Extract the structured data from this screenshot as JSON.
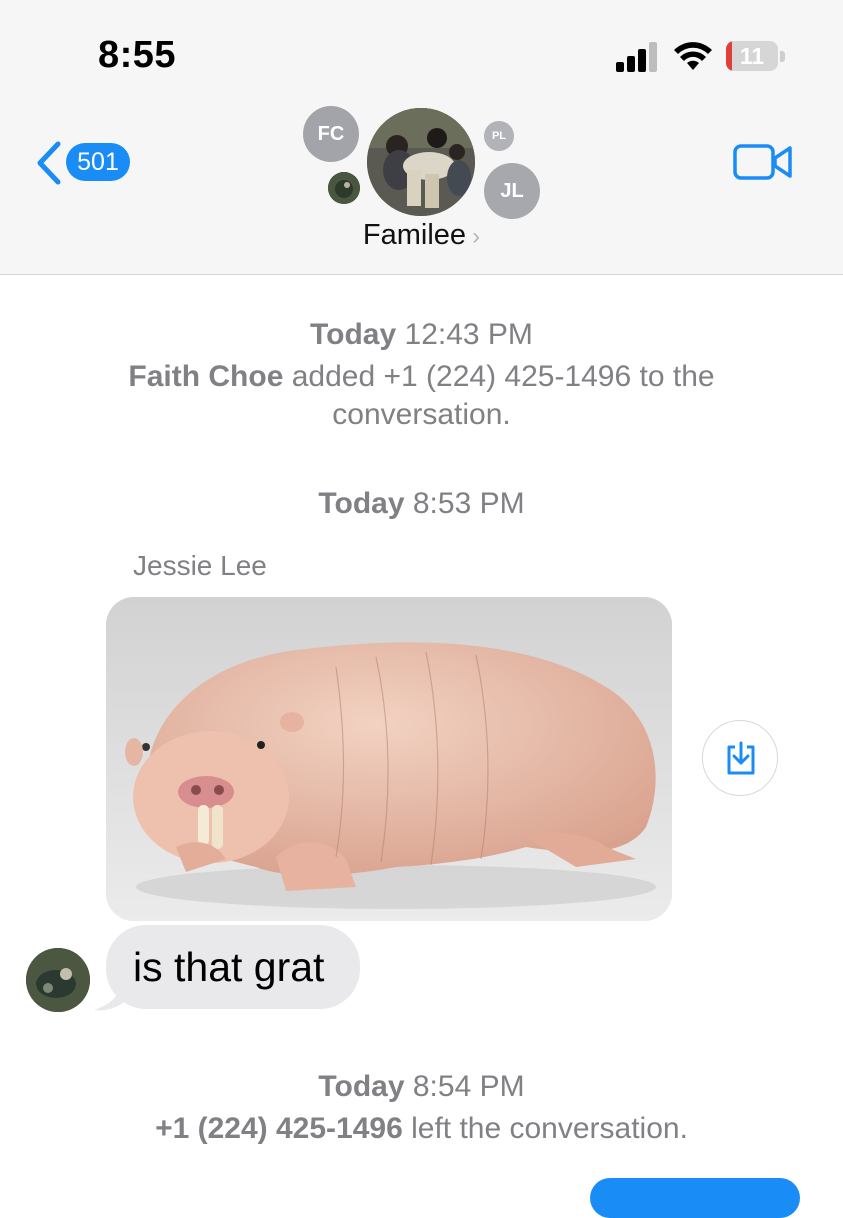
{
  "status_bar": {
    "time": "8:55",
    "battery_text": "11",
    "battery_level_percent": 11
  },
  "nav": {
    "back_count": "501",
    "group_name": "Familee",
    "participants": {
      "fc": "FC",
      "pl": "PL",
      "jl": "JL"
    }
  },
  "icons": {
    "back": "chevron-left-icon",
    "video": "video-camera-icon",
    "save": "download-icon",
    "wifi": "wifi-icon",
    "signal": "cellular-signal-icon"
  },
  "colors": {
    "accent": "#1a8cf6",
    "battery_low": "#e0403a",
    "system_text": "#808085",
    "received_bubble": "#e9e9eb"
  },
  "messages": {
    "event1": {
      "day": "Today",
      "time": "12:43 PM",
      "actor": "Faith Choe",
      "text_before_number": " added ",
      "number": "+1 (224) 425-1496",
      "text_after": " to the conversation."
    },
    "event2": {
      "day": "Today",
      "time": "8:53 PM"
    },
    "sender_name": "Jessie Lee",
    "text_bubble": "is that grat",
    "event3": {
      "day": "Today",
      "time": "8:54 PM",
      "number": "+1 (224) 425-1496",
      "text_after": " left the conversation."
    }
  }
}
